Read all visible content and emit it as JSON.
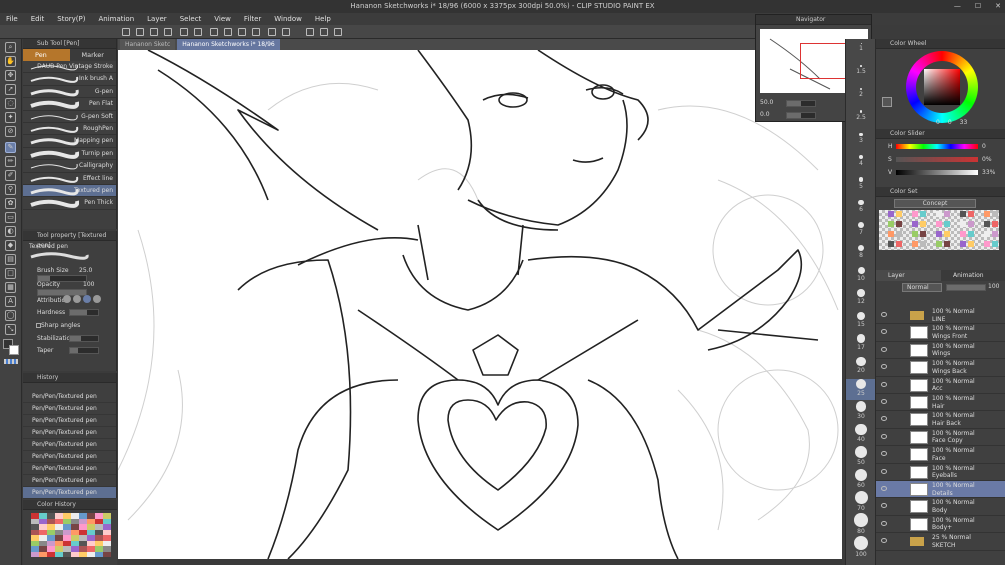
{
  "window": {
    "title": "Hananon Sketchworks i* 18/96 (6000 x 3375px 300dpi 50.0%) - CLIP STUDIO PAINT EX"
  },
  "menu": [
    "File",
    "Edit",
    "Story(P)",
    "Animation",
    "Layer",
    "Select",
    "View",
    "Filter",
    "Window",
    "Help"
  ],
  "doc_tabs": [
    {
      "label": "Hananon Sketc",
      "active": false
    },
    {
      "label": "Hananon Sketchworks i* 18/96",
      "active": true
    }
  ],
  "subtool": {
    "header": "Sub Tool [Pen]",
    "tabs": [
      {
        "label": "Pen",
        "active": true
      },
      {
        "label": "Marker",
        "active": false
      }
    ],
    "brushes": [
      "DAUB Pen Vintage Stroke",
      "Ink brush A",
      "G-pen",
      "Pen Flat",
      "G-pen Soft",
      "RoughPen",
      "Mapping pen",
      "Turnip pen",
      "Calligraphy",
      "Effect line",
      "Textured pen",
      "Pen Thick"
    ],
    "selected": "Textured pen"
  },
  "toolprop": {
    "header": "Tool property [Textured pen]",
    "name": "Textured pen",
    "brush_size_label": "Brush Size",
    "brush_size": "25.0",
    "opacity_label": "Opacity",
    "opacity": "100",
    "attribution_label": "Attribution",
    "hardness_label": "Hardness",
    "sharp_angles_label": "Sharp angles",
    "stabilization_label": "Stabilization",
    "taper_label": "Taper"
  },
  "history": {
    "header": "History",
    "items": [
      "Pen/Pen/Textured pen",
      "Pen/Pen/Textured pen",
      "Pen/Pen/Textured pen",
      "Pen/Pen/Textured pen",
      "Pen/Pen/Textured pen",
      "Pen/Pen/Textured pen",
      "Pen/Pen/Textured pen",
      "Pen/Pen/Textured pen",
      "Pen/Pen/Textured pen"
    ]
  },
  "colorhistory": {
    "header": "Color History"
  },
  "navigator": {
    "title": "Navigator",
    "zoom": "50.0",
    "rotation": "0.0"
  },
  "brushsizes": [
    "1",
    "1.5",
    "2",
    "2.5",
    "3",
    "4",
    "5",
    "6",
    "7",
    "8",
    "10",
    "12",
    "15",
    "17",
    "20",
    "25",
    "30",
    "40",
    "50",
    "60",
    "70",
    "80",
    "100"
  ],
  "brushsize_selected": "25",
  "colorwheel": {
    "header": "Color Wheel",
    "values": [
      "0",
      "0",
      "33"
    ]
  },
  "colorslider": {
    "header": "Color Slider",
    "rows": [
      {
        "label": "H",
        "value": "0"
      },
      {
        "label": "S",
        "value": "0%"
      },
      {
        "label": "V",
        "value": "33%"
      }
    ]
  },
  "colorset": {
    "header": "Color Set",
    "set_name": "Concept"
  },
  "layer": {
    "tabs": [
      "Layer",
      "Animation"
    ],
    "blend": "Normal",
    "opacity": "100",
    "folder": {
      "line1": "100 % Normal",
      "line2": "LINE"
    },
    "items": [
      {
        "line1": "100 % Normal",
        "line2": "Wings Front",
        "selected": false
      },
      {
        "line1": "100 % Normal",
        "line2": "Wings",
        "selected": false
      },
      {
        "line1": "100 % Normal",
        "line2": "Wings Back",
        "selected": false
      },
      {
        "line1": "100 % Normal",
        "line2": "Acc",
        "selected": false
      },
      {
        "line1": "100 % Normal",
        "line2": "Hair",
        "selected": false
      },
      {
        "line1": "100 % Normal",
        "line2": "Hair Back",
        "selected": false
      },
      {
        "line1": "100 % Normal",
        "line2": "Face Copy",
        "selected": false
      },
      {
        "line1": "100 % Normal",
        "line2": "Face",
        "selected": false
      },
      {
        "line1": "100 % Normal",
        "line2": "Eyeballs",
        "selected": false
      },
      {
        "line1": "100 % Normal",
        "line2": "Details",
        "selected": true
      },
      {
        "line1": "100 % Normal",
        "line2": "Body",
        "selected": false
      },
      {
        "line1": "100 % Normal",
        "line2": "Body+",
        "selected": false
      }
    ],
    "sketch": {
      "line1": "25 % Normal",
      "line2": "SKETCH"
    }
  },
  "colors": {
    "accent": "#6a7aa6",
    "tab_active": "#b5762b",
    "panel": "#404040"
  }
}
